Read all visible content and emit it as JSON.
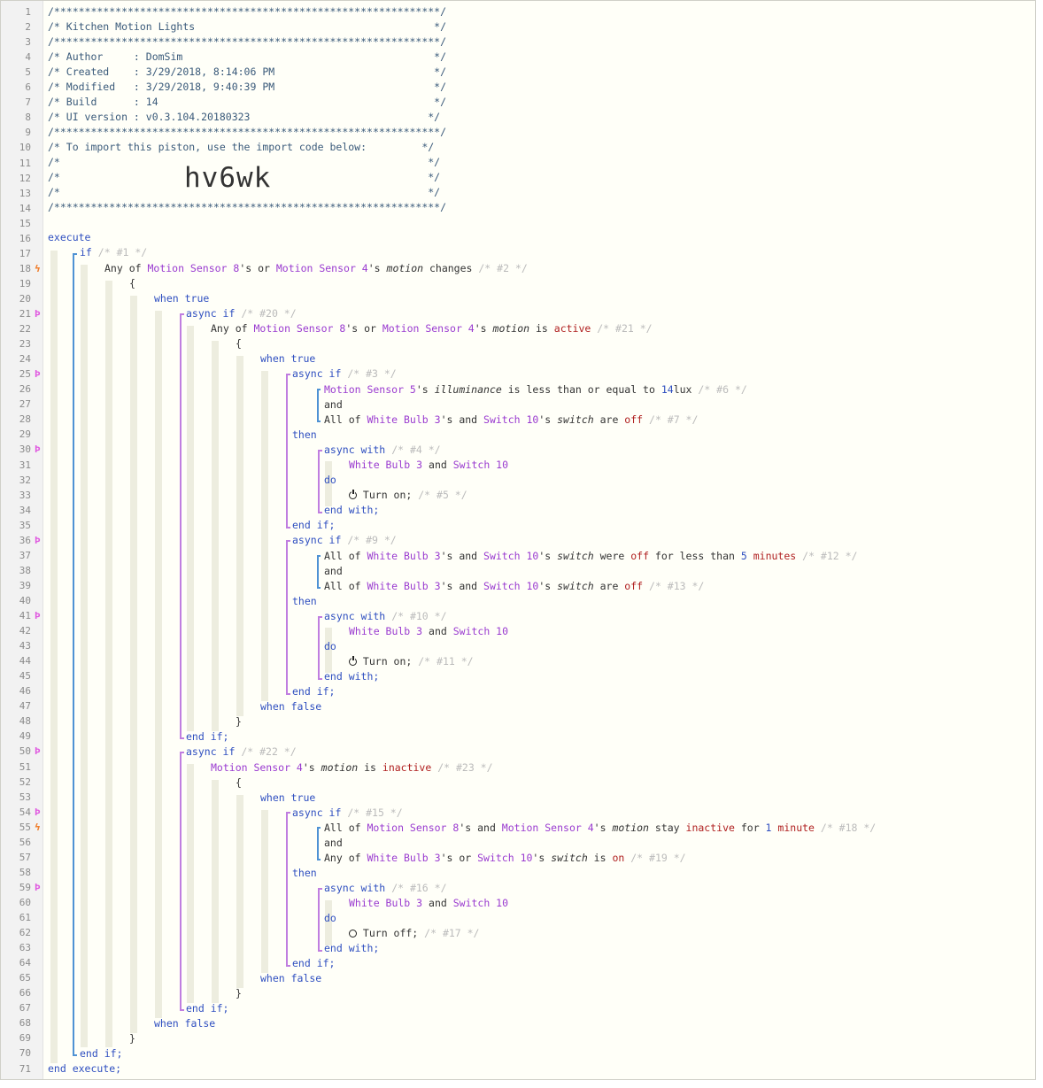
{
  "header": {
    "stars": "/***************************************************************/",
    "title": "/* Kitchen Motion Lights                                       */",
    "author": "/* Author     : DomSim                                         */",
    "created": "/* Created    : 3/29/2018, 8:14:06 PM                          */",
    "modified": "/* Modified   : 3/29/2018, 9:40:39 PM                          */",
    "build": "/* Build      : 14                                             */",
    "ui_version": "/* UI version : v0.3.104.20180323                             */",
    "import_note": "/* To import this piston, use the import code below:         */",
    "blank": "/*                                                            */",
    "import_code": "hv6wk"
  },
  "keywords": {
    "execute": "execute",
    "end_execute": "end execute;",
    "if": "if",
    "async_if": "async if",
    "async_with": "async with",
    "when_true": "when true",
    "when_false": "when false",
    "then": "then",
    "do": "do",
    "and": "and",
    "end_if": "end if;",
    "end_with": "end with;",
    "open_brace": "{",
    "close_brace": "}"
  },
  "devices": {
    "ms8": "Motion Sensor 8",
    "ms4": "Motion Sensor 4",
    "ms5": "Motion Sensor 5",
    "wb3": "White Bulb 3",
    "sw10": "Switch 10"
  },
  "attrs": {
    "motion": "motion",
    "illuminance": "illuminance",
    "switch": "switch"
  },
  "values": {
    "active": "active",
    "inactive": "inactive",
    "off": "off",
    "on": "on",
    "lux_num": "14",
    "lux_unit": "lux",
    "min5_num": "5",
    "min5_unit": "minutes",
    "min1_num": "1",
    "min1_unit": "minute"
  },
  "text": {
    "any_of": "Any of ",
    "all_of": "All of ",
    "s_or": "'s or ",
    "s_and": "'s and ",
    "s_": "'s ",
    "or": " or ",
    "and_sp": " and ",
    "changes": " changes ",
    "is_": " is ",
    "are_": " are ",
    "were_": " were ",
    "stay_": " stay ",
    "less_equal": " is less than or equal to ",
    "for_less": " for less than ",
    "for_": " for ",
    "turn_on": " Turn on; ",
    "turn_off": " Turn off; "
  },
  "comments": {
    "c1": "/* #1 */",
    "c2": "/* #2 */",
    "c20": "/* #20 */",
    "c21": "/* #21 */",
    "c3": "/* #3 */",
    "c6": "/* #6 */",
    "c7": "/* #7 */",
    "c4": "/* #4 */",
    "c5": "/* #5 */",
    "c9": "/* #9 */",
    "c12": "/* #12 */",
    "c13": "/* #13 */",
    "c10": "/* #10 */",
    "c11": "/* #11 */",
    "c22": "/* #22 */",
    "c23": "/* #23 */",
    "c15": "/* #15 */",
    "c18": "/* #18 */",
    "c19": "/* #19 */",
    "c16": "/* #16 */",
    "c17": "/* #17 */"
  },
  "gutter": {
    "line_numbers": [
      1,
      2,
      3,
      4,
      5,
      6,
      7,
      8,
      9,
      10,
      11,
      12,
      13,
      14,
      15,
      16,
      17,
      18,
      19,
      20,
      21,
      22,
      23,
      24,
      25,
      26,
      27,
      28,
      29,
      30,
      31,
      32,
      33,
      34,
      35,
      36,
      37,
      38,
      39,
      40,
      41,
      42,
      43,
      44,
      45,
      46,
      47,
      48,
      49,
      50,
      51,
      52,
      53,
      54,
      55,
      56,
      57,
      58,
      59,
      60,
      61,
      62,
      63,
      64,
      65,
      66,
      67,
      68,
      69,
      70,
      71
    ],
    "marker_async_lines": [
      21,
      25,
      30,
      36,
      41,
      50,
      54,
      59
    ],
    "marker_trigger_lines": [
      18,
      55
    ],
    "async_glyph": "Þ",
    "trigger_glyph": "ϟ"
  },
  "colors": {
    "keyword": "#2f4fc0",
    "device": "#9a3bd0",
    "value": "#b02020",
    "comment": "#bbbbbb"
  }
}
